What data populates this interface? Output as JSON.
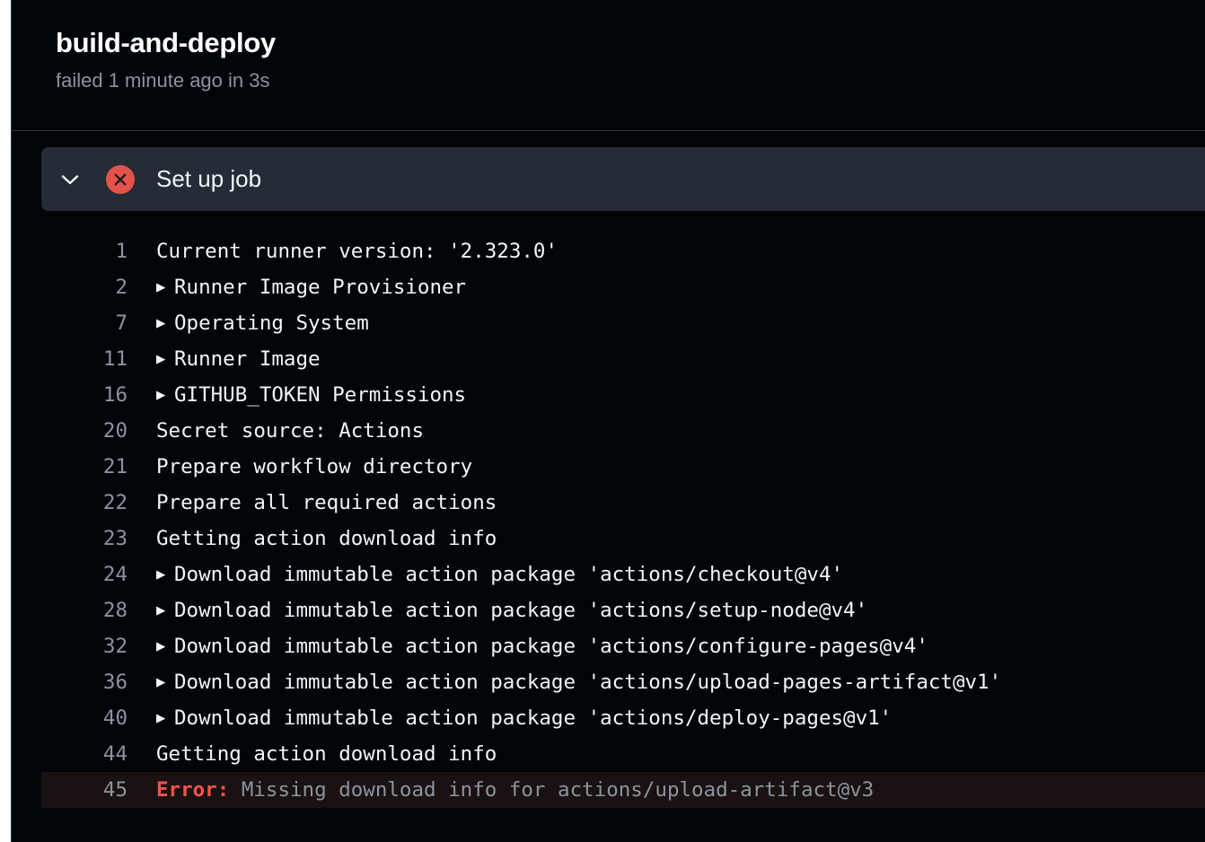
{
  "job": {
    "title": "build-and-deploy",
    "status": "failed 1 minute ago in 3s"
  },
  "step": {
    "title": "Set up job",
    "status": "failed",
    "expanded": true,
    "colors": {
      "fail": "#e5534b",
      "header_bg": "#262c36"
    }
  },
  "log": {
    "lines": [
      {
        "num": "1",
        "text": "Current runner version: '2.323.0'",
        "expandable": false
      },
      {
        "num": "2",
        "text": "Runner Image Provisioner",
        "expandable": true
      },
      {
        "num": "7",
        "text": "Operating System",
        "expandable": true
      },
      {
        "num": "11",
        "text": "Runner Image",
        "expandable": true
      },
      {
        "num": "16",
        "text": "GITHUB_TOKEN Permissions",
        "expandable": true
      },
      {
        "num": "20",
        "text": "Secret source: Actions",
        "expandable": false
      },
      {
        "num": "21",
        "text": "Prepare workflow directory",
        "expandable": false
      },
      {
        "num": "22",
        "text": "Prepare all required actions",
        "expandable": false
      },
      {
        "num": "23",
        "text": "Getting action download info",
        "expandable": false
      },
      {
        "num": "24",
        "text": "Download immutable action package 'actions/checkout@v4'",
        "expandable": true
      },
      {
        "num": "28",
        "text": "Download immutable action package 'actions/setup-node@v4'",
        "expandable": true
      },
      {
        "num": "32",
        "text": "Download immutable action package 'actions/configure-pages@v4'",
        "expandable": true
      },
      {
        "num": "36",
        "text": "Download immutable action package 'actions/upload-pages-artifact@v1'",
        "expandable": true
      },
      {
        "num": "40",
        "text": "Download immutable action package 'actions/deploy-pages@v1'",
        "expandable": true
      },
      {
        "num": "44",
        "text": "Getting action download info",
        "expandable": false
      }
    ],
    "error_line": {
      "num": "45",
      "label": "Error:",
      "message": " Missing download info for actions/upload-artifact@v3"
    }
  },
  "icons": {
    "chevron": "chevron-down-icon",
    "fail": "x-circle-fill-icon",
    "expand": "triangle-right-icon"
  }
}
